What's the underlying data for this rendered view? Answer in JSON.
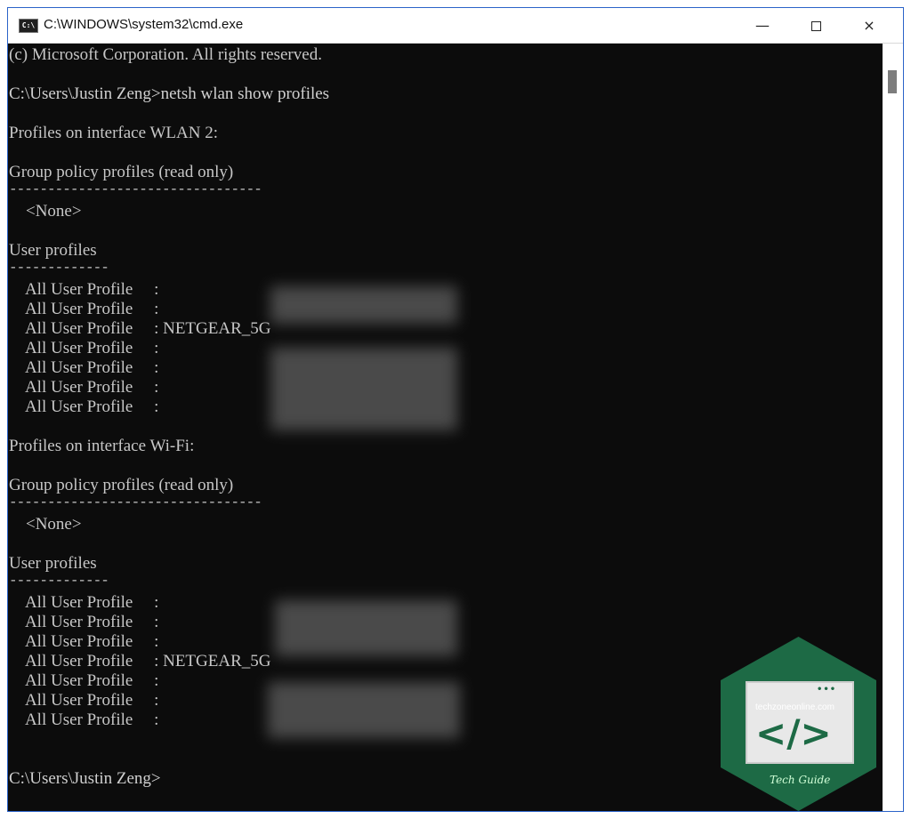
{
  "window": {
    "title": "C:\\WINDOWS\\system32\\cmd.exe",
    "controls": {
      "minimize": "—",
      "close": "×"
    }
  },
  "console": {
    "lines": [
      "(c) Microsoft Corporation. All rights reserved.",
      "",
      "C:\\Users\\Justin Zeng>netsh wlan show profiles",
      "",
      "Profiles on interface WLAN 2:",
      "",
      "Group policy profiles (read only)",
      "---------------------------------",
      "    <None>",
      "",
      "User profiles",
      "-------------",
      "    All User Profile     :",
      "    All User Profile     :",
      "    All User Profile     : NETGEAR_5G",
      "    All User Profile     :",
      "    All User Profile     :",
      "    All User Profile     :",
      "    All User Profile     :",
      "",
      "Profiles on interface Wi-Fi:",
      "",
      "Group policy profiles (read only)",
      "---------------------------------",
      "    <None>",
      "",
      "User profiles",
      "-------------",
      "    All User Profile     :",
      "    All User Profile     :",
      "    All User Profile     :",
      "    All User Profile     : NETGEAR_5G",
      "    All User Profile     :",
      "    All User Profile     :",
      "    All User Profile     :",
      "",
      "",
      "C:\\Users\\Justin Zeng>"
    ]
  },
  "watermark": {
    "site": "techzoneonline.com",
    "label": "Tech Guide",
    "code_symbol": "</>",
    "dots": "•••"
  },
  "icons": {
    "app": "cmd-icon",
    "minimize": "minimize-icon",
    "maximize": "maximize-icon",
    "close": "close-icon",
    "watermark": "code-icon"
  },
  "colors": {
    "console_bg": "#0c0c0c",
    "console_text": "#c7c7c7",
    "titlebar_bg": "#ffffff",
    "watermark_bg": "#1d6a45"
  }
}
